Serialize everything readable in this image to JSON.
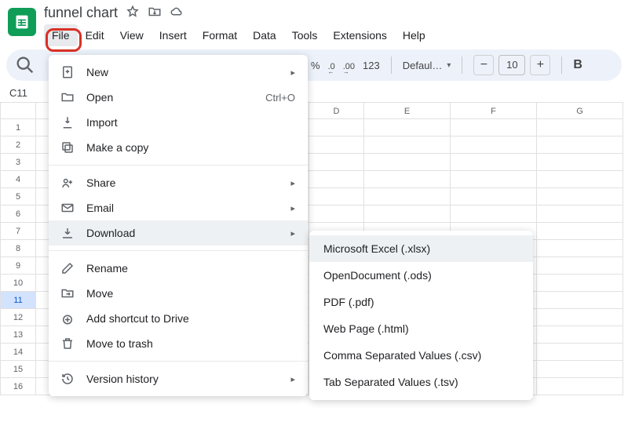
{
  "doc": {
    "title": "funnel chart"
  },
  "menubar": [
    "File",
    "Edit",
    "View",
    "Insert",
    "Format",
    "Data",
    "Tools",
    "Extensions",
    "Help"
  ],
  "toolbar": {
    "percent": "%",
    "dec_dec": ".0",
    "dec_inc": ".00",
    "num_fmt": "123",
    "font": "Defaul…",
    "zoom": "10",
    "bold": "B"
  },
  "namebox": "C11",
  "columns": [
    "D",
    "E",
    "F",
    "G"
  ],
  "row_numbers": [
    "1",
    "2",
    "3",
    "4",
    "5",
    "6",
    "7",
    "8",
    "9",
    "10",
    "11",
    "12",
    "13",
    "14",
    "15",
    "16"
  ],
  "selected_row": "11",
  "file_menu": {
    "new": "New",
    "open": "Open",
    "open_shortcut": "Ctrl+O",
    "import": "Import",
    "copy": "Make a copy",
    "share": "Share",
    "email": "Email",
    "download": "Download",
    "rename": "Rename",
    "move": "Move",
    "shortcut": "Add shortcut to Drive",
    "trash": "Move to trash",
    "version": "Version history"
  },
  "download_menu": {
    "xlsx": "Microsoft Excel (.xlsx)",
    "ods": "OpenDocument (.ods)",
    "pdf": "PDF (.pdf)",
    "html": "Web Page (.html)",
    "csv": "Comma Separated Values (.csv)",
    "tsv": "Tab Separated Values (.tsv)"
  }
}
